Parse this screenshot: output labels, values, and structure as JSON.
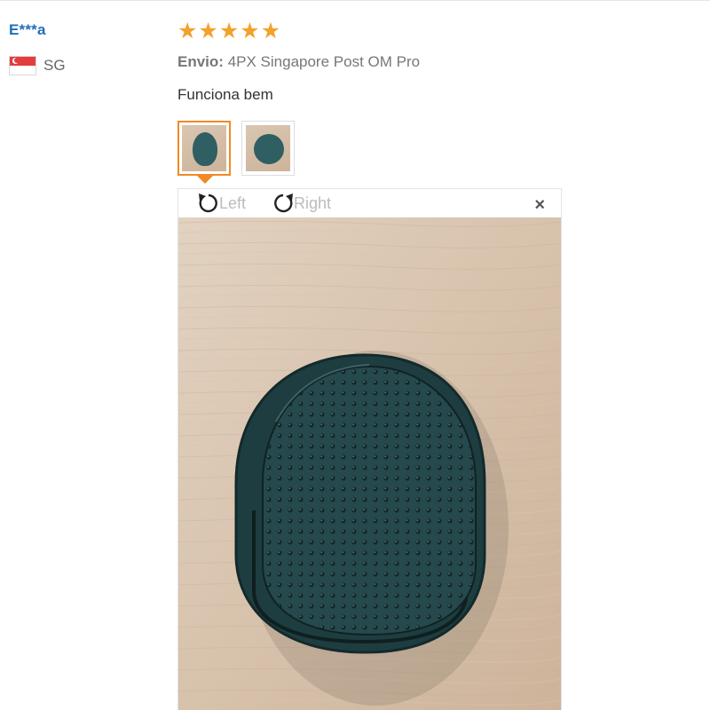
{
  "buyer": {
    "name": "E***a",
    "country_code": "SG"
  },
  "review": {
    "rating": 5,
    "stars": [
      "★",
      "★",
      "★",
      "★",
      "★"
    ],
    "shipping_label": "Envio:",
    "shipping_method": "4PX Singapore Post OM Pro",
    "text": "Funciona bem",
    "photo_count": 2,
    "selected_photo": 1
  },
  "viewer": {
    "rotate_left_label": "Left",
    "rotate_right_label": "Right",
    "close_label": "×"
  },
  "colors": {
    "star": "#f2a22b",
    "thumb_active": "#f08a24",
    "buyer_name": "#1f6fb5"
  }
}
